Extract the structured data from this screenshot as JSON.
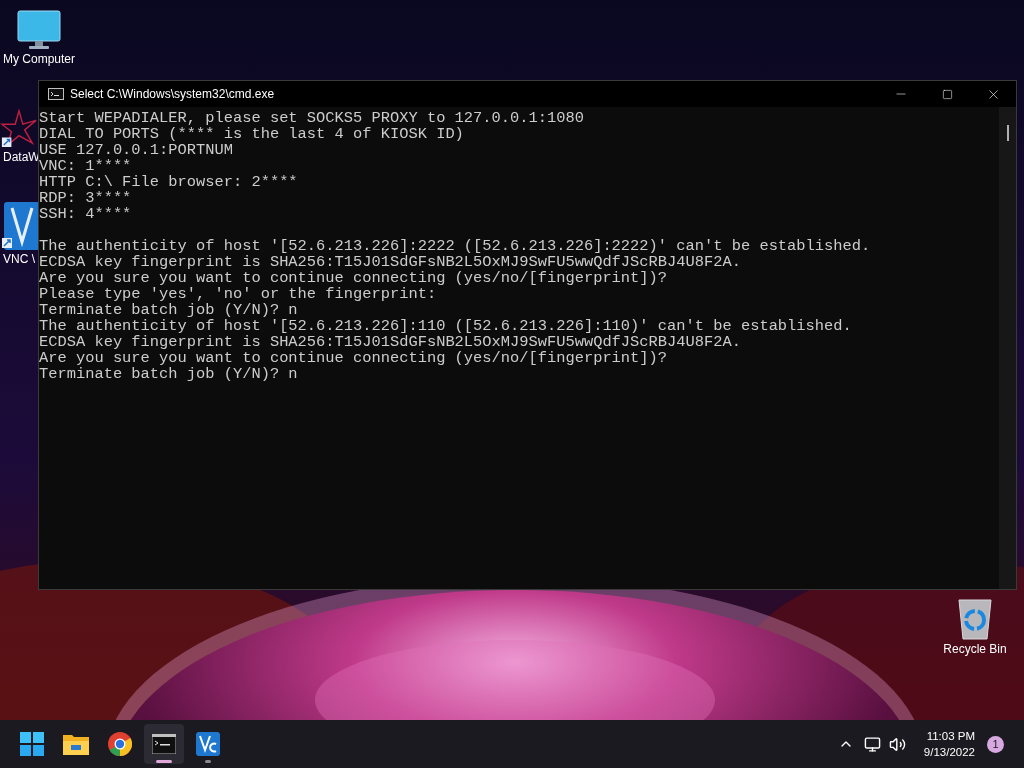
{
  "desktop_icons": [
    {
      "kind": "computer",
      "label": "My Computer"
    },
    {
      "kind": "datawedge",
      "label": "DataW"
    },
    {
      "kind": "vnc",
      "label": "VNC \\"
    },
    {
      "kind": "recycle",
      "label": "Recycle Bin"
    }
  ],
  "window": {
    "title": "Select C:\\Windows\\system32\\cmd.exe",
    "blocks": [
      [
        "Start WEPADIALER, please set SOCKS5 PROXY to 127.0.0.1:1080",
        "DIAL TO PORTS (**** is the last 4 of KIOSK ID)",
        "USE 127.0.0.1:PORTNUM",
        "VNC: 1****",
        "HTTP C:\\ File browser: 2****",
        "RDP: 3****",
        "SSH: 4****"
      ],
      [
        "The authenticity of host '[52.6.213.226]:2222 ([52.6.213.226]:2222)' can't be established.",
        "ECDSA key fingerprint is SHA256:T15J01SdGFsNB2L5OxMJ9SwFU5wwQdfJScRBJ4U8F2A.",
        "Are you sure you want to continue connecting (yes/no/[fingerprint])?",
        "Please type 'yes', 'no' or the fingerprint:",
        "Terminate batch job (Y/N)? n",
        "The authenticity of host '[52.6.213.226]:110 ([52.6.213.226]:110)' can't be established.",
        "ECDSA key fingerprint is SHA256:T15J01SdGFsNB2L5OxMJ9SwFU5wwQdfJScRBJ4U8F2A.",
        "Are you sure you want to continue connecting (yes/no/[fingerprint])?",
        "Terminate batch job (Y/N)? n"
      ]
    ]
  },
  "taskbar": {
    "apps": [
      {
        "kind": "start",
        "running": false,
        "selected": false
      },
      {
        "kind": "explorer",
        "running": false,
        "selected": false
      },
      {
        "kind": "chrome",
        "running": false,
        "selected": false
      },
      {
        "kind": "terminal",
        "running": true,
        "selected": true
      },
      {
        "kind": "vnc",
        "running": true,
        "selected": false
      }
    ],
    "time": "11:03 PM",
    "date": "9/13/2022",
    "notification_count": "1"
  }
}
